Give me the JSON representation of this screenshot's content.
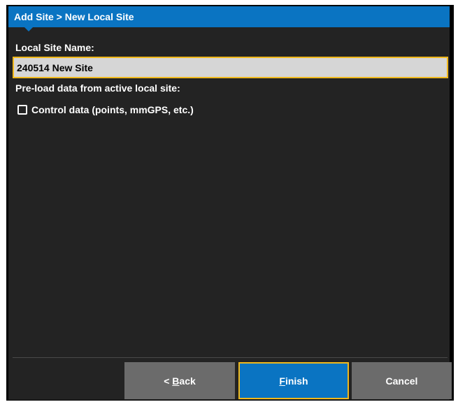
{
  "dialog": {
    "title": "Add Site > New Local Site"
  },
  "form": {
    "site_name_label": "Local Site Name:",
    "site_name_value": "240514 New Site",
    "preload_label": "Pre-load data from active local site:",
    "control_data_label": "Control data (points, mmGPS, etc.)",
    "control_data_checked": false
  },
  "buttons": {
    "back_prefix": "< ",
    "back_mnemonic": "B",
    "back_rest": "ack",
    "finish_mnemonic": "F",
    "finish_rest": "inish",
    "cancel_label": "Cancel"
  },
  "colors": {
    "title_bar": "#0a74c2",
    "panel_bg": "#232323",
    "focus_border": "#f0b81c",
    "button_gray": "#6b6b6b"
  }
}
